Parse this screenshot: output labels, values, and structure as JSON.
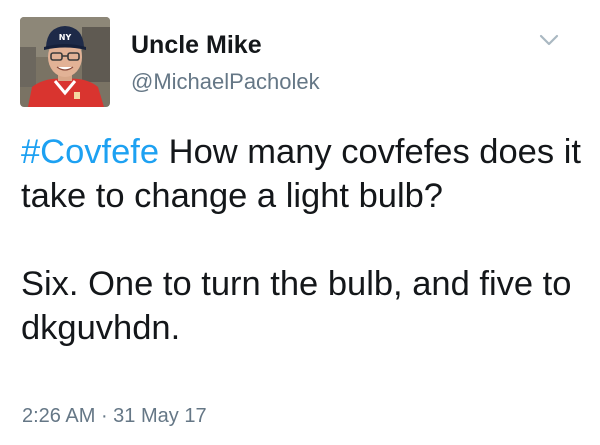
{
  "author": {
    "display_name": "Uncle Mike",
    "handle": "@MichaelPacholek",
    "avatar_cap_logo": "NY"
  },
  "tweet": {
    "hashtag": "#Covfefe",
    "first_line_text": " How many covfefes does it take to change a light bulb?",
    "second_paragraph": "Six. One to turn the bulb, and five to dkguvhdn.",
    "time": "2:26 AM",
    "separator": " · ",
    "date": "31 May 17"
  },
  "icons": {
    "menu": "chevron-down-icon"
  },
  "colors": {
    "link": "#1da1f2",
    "text": "#14171a",
    "secondary": "#657786"
  }
}
